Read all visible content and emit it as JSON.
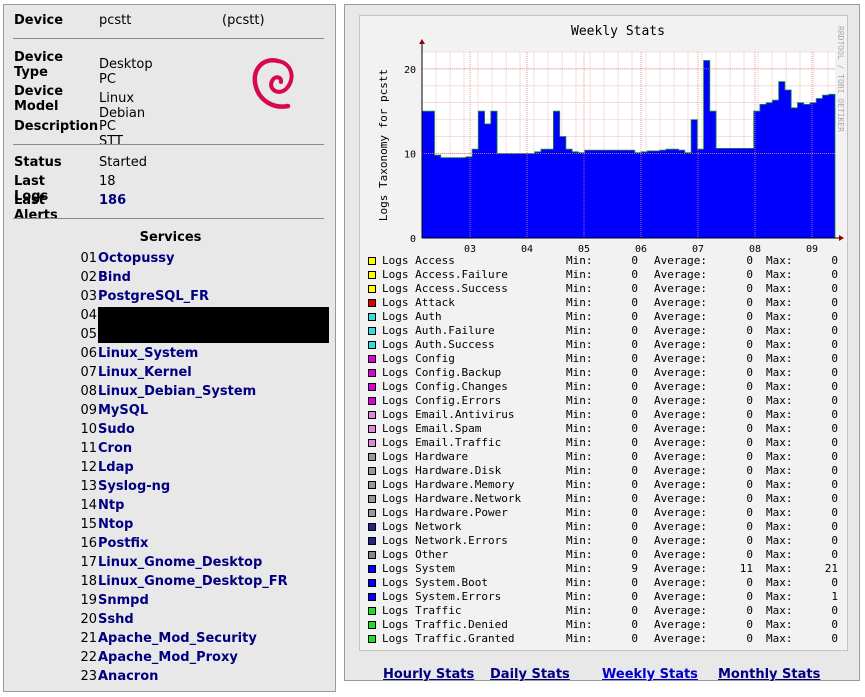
{
  "device": {
    "device_label": "Device",
    "device_value": "pcstt",
    "device_alias": "(pcstt)",
    "type_label_1": "Device",
    "type_label_2": "Type",
    "type_value": "Desktop PC",
    "model_label_1": "Device",
    "model_label_2": "Model",
    "model_value": "Linux Debian",
    "description_label": "Description",
    "description_value": "PC STT",
    "logo_icon": "debian-swirl-icon",
    "logo_color": "#d70751"
  },
  "status": {
    "status_label": "Status",
    "status_value": "Started",
    "last_logs_label": "Last Logs",
    "last_logs_value": "18",
    "last_alerts_label": "Last Alerts",
    "last_alerts_value": "186"
  },
  "services": {
    "title": "Services",
    "items": [
      {
        "num": "01",
        "name": "Octopussy"
      },
      {
        "num": "02",
        "name": "Bind"
      },
      {
        "num": "03",
        "name": "PostgreSQL_FR"
      },
      {
        "num": "04",
        "name": ""
      },
      {
        "num": "05",
        "name": ""
      },
      {
        "num": "06",
        "name": "Linux_System"
      },
      {
        "num": "07",
        "name": "Linux_Kernel"
      },
      {
        "num": "08",
        "name": "Linux_Debian_System"
      },
      {
        "num": "09",
        "name": "MySQL"
      },
      {
        "num": "10",
        "name": "Sudo"
      },
      {
        "num": "11",
        "name": "Cron"
      },
      {
        "num": "12",
        "name": "Ldap"
      },
      {
        "num": "13",
        "name": "Syslog-ng"
      },
      {
        "num": "14",
        "name": "Ntp"
      },
      {
        "num": "15",
        "name": "Ntop"
      },
      {
        "num": "16",
        "name": "Postfix"
      },
      {
        "num": "17",
        "name": "Linux_Gnome_Desktop"
      },
      {
        "num": "18",
        "name": "Linux_Gnome_Desktop_FR"
      },
      {
        "num": "19",
        "name": "Snmpd"
      },
      {
        "num": "20",
        "name": "Sshd"
      },
      {
        "num": "21",
        "name": "Apache_Mod_Security"
      },
      {
        "num": "22",
        "name": "Apache_Mod_Proxy"
      },
      {
        "num": "23",
        "name": "Anacron"
      }
    ]
  },
  "chart_data": {
    "type": "area",
    "title": "Weekly Stats",
    "ylabel": "Logs Taxonomy for pcstt",
    "side_text": "RRDTOOL / TOBI OETIKER",
    "categories": [
      "03",
      "04",
      "05",
      "06",
      "07",
      "08",
      "09"
    ],
    "ylim": [
      0,
      22
    ],
    "yticks": [
      0,
      10,
      20
    ],
    "grid": true,
    "series": [
      {
        "name": "Logs System",
        "color": "#0000ff",
        "values": [
          15,
          15,
          9.8,
          9.5,
          9.5,
          9.5,
          9.5,
          9.6,
          10.5,
          15,
          13.5,
          15,
          10,
          10,
          10,
          10,
          10,
          10,
          10.2,
          10.5,
          10.5,
          15,
          12,
          10.5,
          10.2,
          10.1,
          10.4,
          10.4,
          10.4,
          10.4,
          10.4,
          10.4,
          10.4,
          10.4,
          10.1,
          10.2,
          10.3,
          10.3,
          10.4,
          10.5,
          10.5,
          10.4,
          10.1,
          14,
          10.5,
          21,
          15,
          10.6,
          10.6,
          10.6,
          10.6,
          10.6,
          10.6,
          15,
          15.8,
          16,
          16.3,
          18.5,
          17.5,
          15.4,
          16,
          15.8,
          16,
          16.5,
          16.9,
          17
        ]
      }
    ]
  },
  "legend": {
    "min_label": "Min:",
    "avg_label": "Average:",
    "max_label": "Max:",
    "items": [
      {
        "name": "Logs Access",
        "color": "#ffff00",
        "min": "0",
        "avg": "0",
        "max": "0"
      },
      {
        "name": "Logs Access.Failure",
        "color": "#ffff00",
        "min": "0",
        "avg": "0",
        "max": "0"
      },
      {
        "name": "Logs Access.Success",
        "color": "#ffff00",
        "min": "0",
        "avg": "0",
        "max": "0"
      },
      {
        "name": "Logs Attack",
        "color": "#dd0000",
        "min": "0",
        "avg": "0",
        "max": "0"
      },
      {
        "name": "Logs Auth",
        "color": "#33dddd",
        "min": "0",
        "avg": "0",
        "max": "0"
      },
      {
        "name": "Logs Auth.Failure",
        "color": "#33dddd",
        "min": "0",
        "avg": "0",
        "max": "0"
      },
      {
        "name": "Logs Auth.Success",
        "color": "#33dddd",
        "min": "0",
        "avg": "0",
        "max": "0"
      },
      {
        "name": "Logs Config",
        "color": "#dd00dd",
        "min": "0",
        "avg": "0",
        "max": "0"
      },
      {
        "name": "Logs Config.Backup",
        "color": "#dd00dd",
        "min": "0",
        "avg": "0",
        "max": "0"
      },
      {
        "name": "Logs Config.Changes",
        "color": "#dd00dd",
        "min": "0",
        "avg": "0",
        "max": "0"
      },
      {
        "name": "Logs Config.Errors",
        "color": "#dd00dd",
        "min": "0",
        "avg": "0",
        "max": "0"
      },
      {
        "name": "Logs Email.Antivirus",
        "color": "#dd88dd",
        "min": "0",
        "avg": "0",
        "max": "0"
      },
      {
        "name": "Logs Email.Spam",
        "color": "#dd88dd",
        "min": "0",
        "avg": "0",
        "max": "0"
      },
      {
        "name": "Logs Email.Traffic",
        "color": "#dd88dd",
        "min": "0",
        "avg": "0",
        "max": "0"
      },
      {
        "name": "Logs Hardware",
        "color": "#999999",
        "min": "0",
        "avg": "0",
        "max": "0"
      },
      {
        "name": "Logs Hardware.Disk",
        "color": "#999999",
        "min": "0",
        "avg": "0",
        "max": "0"
      },
      {
        "name": "Logs Hardware.Memory",
        "color": "#999999",
        "min": "0",
        "avg": "0",
        "max": "0"
      },
      {
        "name": "Logs Hardware.Network",
        "color": "#999999",
        "min": "0",
        "avg": "0",
        "max": "0"
      },
      {
        "name": "Logs Hardware.Power",
        "color": "#999999",
        "min": "0",
        "avg": "0",
        "max": "0"
      },
      {
        "name": "Logs Network",
        "color": "#222288",
        "min": "0",
        "avg": "0",
        "max": "0"
      },
      {
        "name": "Logs Network.Errors",
        "color": "#222288",
        "min": "0",
        "avg": "0",
        "max": "0"
      },
      {
        "name": "Logs Other",
        "color": "#888888",
        "min": "0",
        "avg": "0",
        "max": "0"
      },
      {
        "name": "Logs System",
        "color": "#0000ff",
        "min": "9",
        "avg": "11",
        "max": "21"
      },
      {
        "name": "Logs System.Boot",
        "color": "#0000ff",
        "min": "0",
        "avg": "0",
        "max": "0"
      },
      {
        "name": "Logs System.Errors",
        "color": "#0000ff",
        "min": "0",
        "avg": "0",
        "max": "1"
      },
      {
        "name": "Logs Traffic",
        "color": "#22dd22",
        "min": "0",
        "avg": "0",
        "max": "0"
      },
      {
        "name": "Logs Traffic.Denied",
        "color": "#22dd22",
        "min": "0",
        "avg": "0",
        "max": "0"
      },
      {
        "name": "Logs Traffic.Granted",
        "color": "#22dd22",
        "min": "0",
        "avg": "0",
        "max": "0"
      }
    ]
  },
  "footer": {
    "hourly": "Hourly Stats",
    "daily": "Daily Stats",
    "weekly": "Weekly Stats",
    "monthly": "Monthly Stats",
    "link_color": "#000080",
    "active_color": "#0000cc"
  }
}
